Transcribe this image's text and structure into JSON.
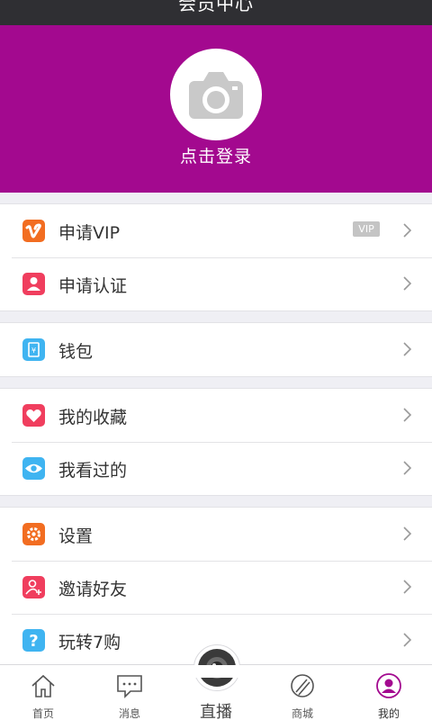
{
  "titlebar": {
    "title": "会员中心"
  },
  "header": {
    "login_label": "点击登录",
    "background": "#a3098f"
  },
  "sections": [
    {
      "items": [
        {
          "label": "申请VIP",
          "icon": "vimeo-icon",
          "badge": "VIP"
        },
        {
          "label": "申请认证",
          "icon": "person-icon"
        }
      ]
    },
    {
      "items": [
        {
          "label": "钱包",
          "icon": "wallet-icon"
        }
      ]
    },
    {
      "items": [
        {
          "label": "我的收藏",
          "icon": "heart-icon"
        },
        {
          "label": "我看过的",
          "icon": "eye-icon"
        }
      ]
    },
    {
      "items": [
        {
          "label": "设置",
          "icon": "gear-icon"
        },
        {
          "label": "邀请好友",
          "icon": "add-user-icon"
        },
        {
          "label": "玩转7购",
          "icon": "help-icon"
        }
      ]
    }
  ],
  "tabbar": {
    "home": "首页",
    "messages": "消息",
    "live": "直播",
    "mall": "商城",
    "mine": "我的"
  }
}
